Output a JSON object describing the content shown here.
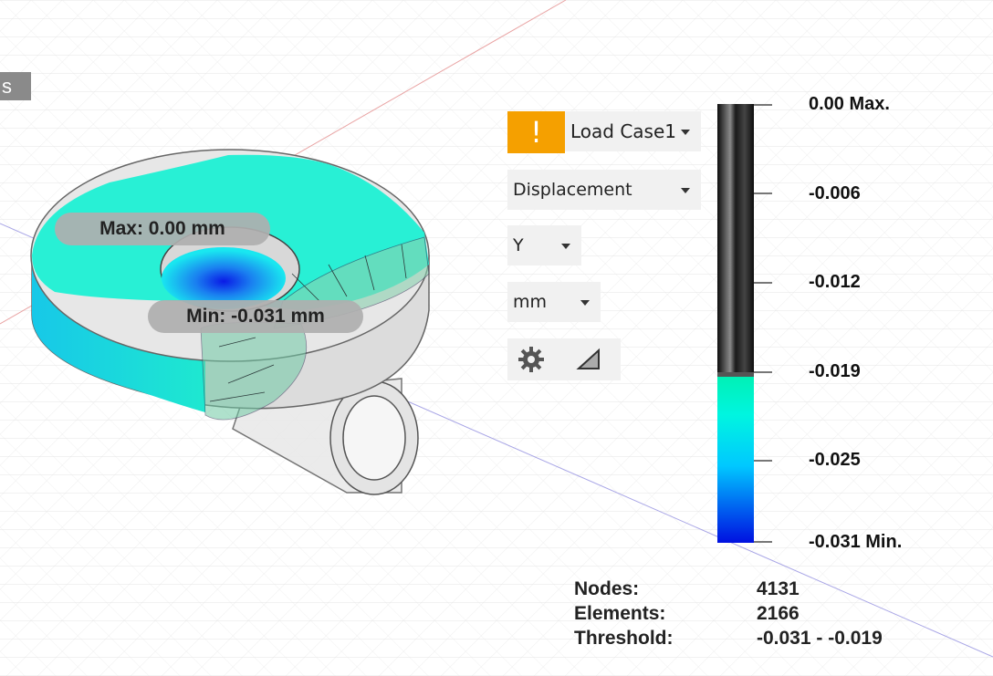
{
  "side_tab": {
    "label": "s"
  },
  "probes": {
    "max_label": "Max: 0.00 mm",
    "min_label": "Min: -0.031 mm"
  },
  "results_panel": {
    "warning_icon": "exclamation-icon",
    "warning_glyph": "!",
    "load_case": "Load Case1",
    "result_type": "Displacement",
    "component": "Y",
    "units": "mm",
    "settings_icon": "gear-icon",
    "plot_icon": "ramp-triangle-icon"
  },
  "legend": {
    "labels": [
      "0.00 Max.",
      "-0.006",
      "-0.012",
      "-0.019",
      "-0.025",
      "-0.031 Min."
    ],
    "colors": {
      "max": "#00f0c0",
      "mid": "#00e0ff",
      "min": "#0010e0",
      "gray": "#2a2a2a"
    }
  },
  "stats": {
    "nodes_label": "Nodes:",
    "nodes_value": "4131",
    "elements_label": "Elements:",
    "elements_value": "2166",
    "threshold_label": "Threshold:",
    "threshold_value": "-0.031 - -0.019"
  }
}
